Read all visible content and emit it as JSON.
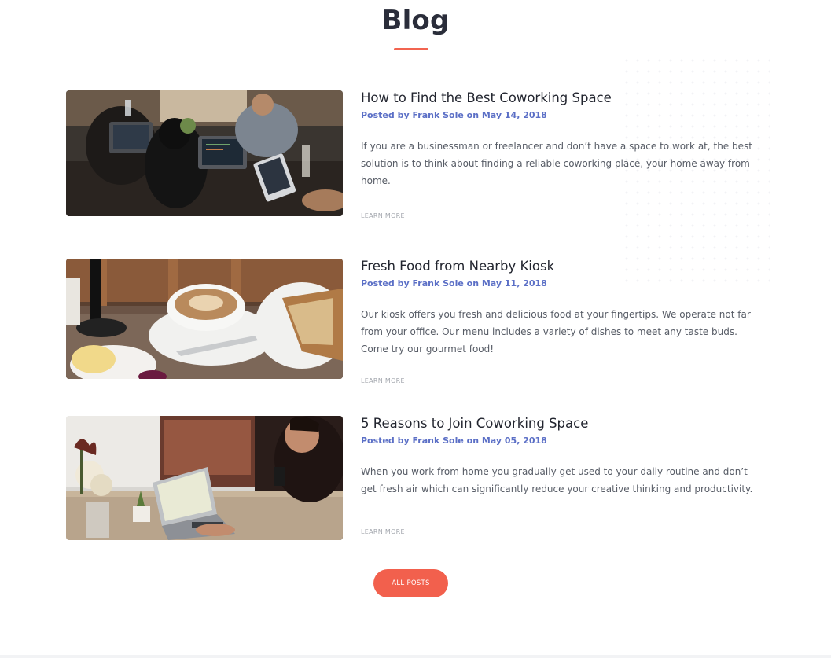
{
  "section": {
    "title": "Blog"
  },
  "posts": [
    {
      "title": "How to Find the Best Coworking Space",
      "meta": "Posted by Frank Sole on May 14, 2018",
      "excerpt": "If you are a businessman or freelancer and don’t have a space to work at, the best solution is to think about finding a reliable coworking place, your home away from home.",
      "link_label": "LEARN MORE",
      "image": "coworking-team-photo"
    },
    {
      "title": "Fresh Food from Nearby Kiosk",
      "meta": "Posted by Frank Sole on May 11, 2018",
      "excerpt": "Our kiosk offers you fresh and delicious food at your fingertips. We operate not far from your office. Our menu includes a variety of dishes to meet any taste buds. Come try our gourmet food!",
      "link_label": "LEARN MORE",
      "image": "coffee-and-bread-photo"
    },
    {
      "title": "5 Reasons to Join Coworking Space",
      "meta": "Posted by Frank Sole on May 05, 2018",
      "excerpt": "When you work from home you gradually get used to your daily routine and don’t get fresh air which can significantly reduce your creative thinking and productivity.",
      "link_label": "LEARN MORE",
      "image": "laptop-work-photo"
    }
  ],
  "all_posts_button": "ALL POSTS",
  "colors": {
    "accent": "#f2604d",
    "meta": "#5b6fc6",
    "heading": "#2a2d3a"
  }
}
